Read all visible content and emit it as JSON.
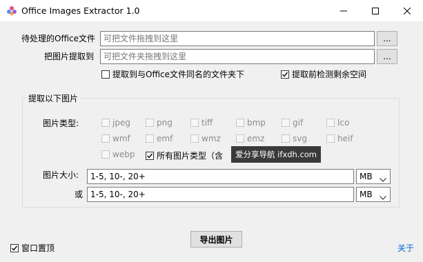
{
  "window": {
    "title": "Office Images Extractor 1.0",
    "icon": "flower-logo-icon",
    "controls": [
      "minimize-icon",
      "maximize-icon",
      "close-icon"
    ]
  },
  "source": {
    "label": "待处理的Office文件",
    "placeholder": "可把文件拖拽到这里",
    "browse_label": "..."
  },
  "target": {
    "label": "把图片提取到",
    "placeholder": "可把文件夹拖拽到这里",
    "browse_label": "..."
  },
  "options": {
    "same_name_folder": {
      "label": "提取到与Office文件同名的文件夹下",
      "checked": false
    },
    "check_space": {
      "label": "提取前检测剩余空间",
      "checked": true
    }
  },
  "group": {
    "title": "提取以下图片",
    "types_label": "图片类型:",
    "types": [
      {
        "label": "jpeg",
        "checked": false
      },
      {
        "label": "png",
        "checked": false
      },
      {
        "label": "tiff",
        "checked": false
      },
      {
        "label": "bmp",
        "checked": false
      },
      {
        "label": "gif",
        "checked": false
      },
      {
        "label": "Ico",
        "checked": false
      },
      {
        "label": "wmf",
        "checked": false
      },
      {
        "label": "emf",
        "checked": false
      },
      {
        "label": "wmz",
        "checked": false
      },
      {
        "label": "emz",
        "checked": false
      },
      {
        "label": "svg",
        "checked": false
      },
      {
        "label": "heif",
        "checked": false
      },
      {
        "label": "webp",
        "checked": false
      }
    ],
    "all_types": {
      "label": "所有图片类型（含",
      "checked": true
    },
    "size_label": "图片大小:",
    "size1": {
      "value": "1-5, 10-, 20+",
      "unit": "MB"
    },
    "or_label": "或",
    "size2": {
      "value": "1-5, 10-, 20+",
      "unit": "MB"
    }
  },
  "watermark": "爱分享导航 ifxdh.com",
  "export_label": "导出图片",
  "topmost": {
    "label": "窗口置顶",
    "checked": true
  },
  "about_label": "关于",
  "colors": {
    "link": "#0066cc",
    "window_bg": "#f0f0f0",
    "watermark_bg": "#3a3a3a"
  }
}
